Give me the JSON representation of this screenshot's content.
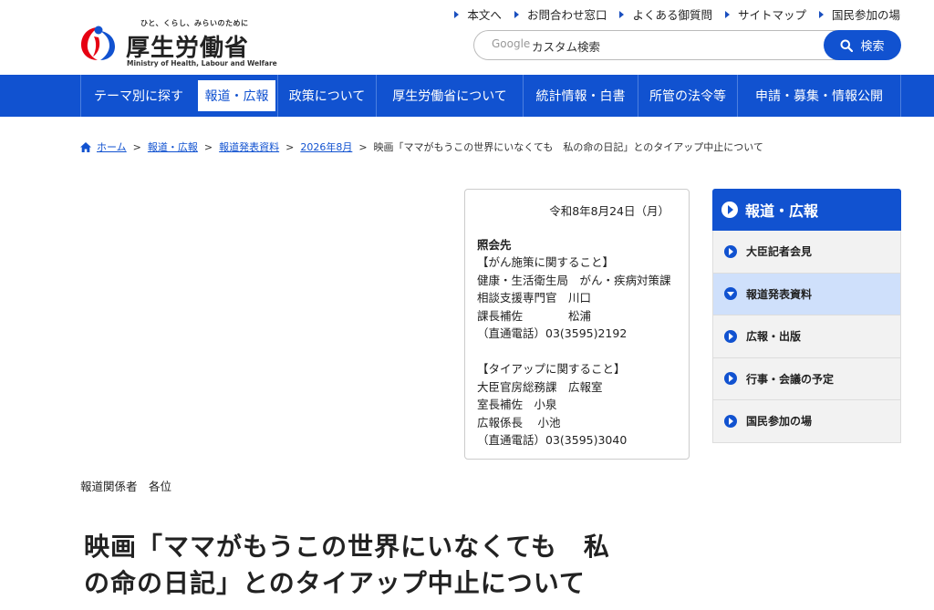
{
  "header": {
    "logo_tagline": "ひと、くらし、みらいのために",
    "logo_name": "厚生労働省",
    "logo_en": "Ministry of Health, Labour and Welfare",
    "util_links": [
      "本文へ",
      "お問合わせ窓口",
      "よくある御質問",
      "サイトマップ",
      "国民参加の場"
    ],
    "search": {
      "brand": "Google",
      "placeholder": "カスタム検索",
      "button_label": "検索"
    }
  },
  "nav": {
    "items": [
      "テーマ別に探す",
      "報道・広報",
      "政策について",
      "厚生労働省について",
      "統計情報・白書",
      "所管の法令等",
      "申請・募集・情報公開"
    ],
    "active_index": 1
  },
  "breadcrumb": {
    "home": "ホーム",
    "items": [
      "報道・広報",
      "報道発表資料",
      "2026年8月"
    ],
    "current": "映画「ママがもうこの世界にいなくても　私の命の日記」とのタイアップ中止について"
  },
  "contact": {
    "date": "令和8年8月24日（月）",
    "heading": "照会先",
    "lines1": [
      "【がん施策に関すること】",
      "健康・生活衛生局　がん・疾病対策課",
      "相談支援専門官　川口",
      "課長補佐　　　　松浦",
      "（直通電話）03(3595)2192"
    ],
    "lines2": [
      "【タイアップに関すること】",
      "大臣官房総務課　広報室",
      "室長補佐　小泉",
      "広報係長　 小池",
      "（直通電話）03(3595)3040"
    ]
  },
  "press_to": "報道関係者　各位",
  "title_line1": "映画「ママがもうこの世界にいなくても　私",
  "title_line2": "の命の日記」とのタイアップ中止について",
  "sidebar": {
    "heading": "報道・広報",
    "items": [
      "大臣記者会見",
      "報道発表資料",
      "広報・出版",
      "行事・会議の予定",
      "国民参加の場"
    ],
    "active_index": 1
  },
  "colors": {
    "brand_blue": "#1152d0",
    "sidebar_active": "#cfe0fb",
    "logo_red": "#e60012"
  }
}
